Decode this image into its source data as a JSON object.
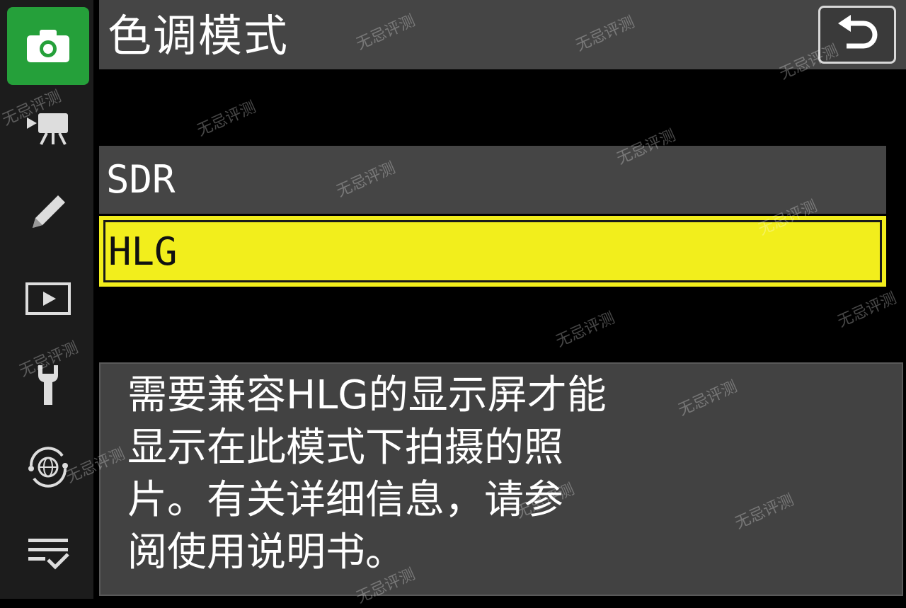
{
  "title": "色调模式",
  "back_button": {
    "icon": "back-arrow-icon"
  },
  "sidebar": {
    "items": [
      {
        "icon": "camera-icon",
        "active": true
      },
      {
        "icon": "movie-camera-icon",
        "active": false
      },
      {
        "icon": "pencil-icon",
        "active": false
      },
      {
        "icon": "play-icon",
        "active": false
      },
      {
        "icon": "wrench-icon",
        "active": false
      },
      {
        "icon": "network-globe-icon",
        "active": false
      },
      {
        "icon": "checklist-icon",
        "active": false
      }
    ]
  },
  "options": [
    {
      "label": "SDR",
      "selected": false
    },
    {
      "label": "HLG",
      "selected": true
    }
  ],
  "help_text": "需要兼容HLG的显示屏才能\n显示在此模式下拍摄的照\n片。有关详细信息，请参\n阅使用说明书。",
  "watermark": "无忌评测",
  "colors": {
    "accent_green": "#25a03a",
    "selection_yellow": "#f2ee1c",
    "bar_gray": "#454545"
  }
}
